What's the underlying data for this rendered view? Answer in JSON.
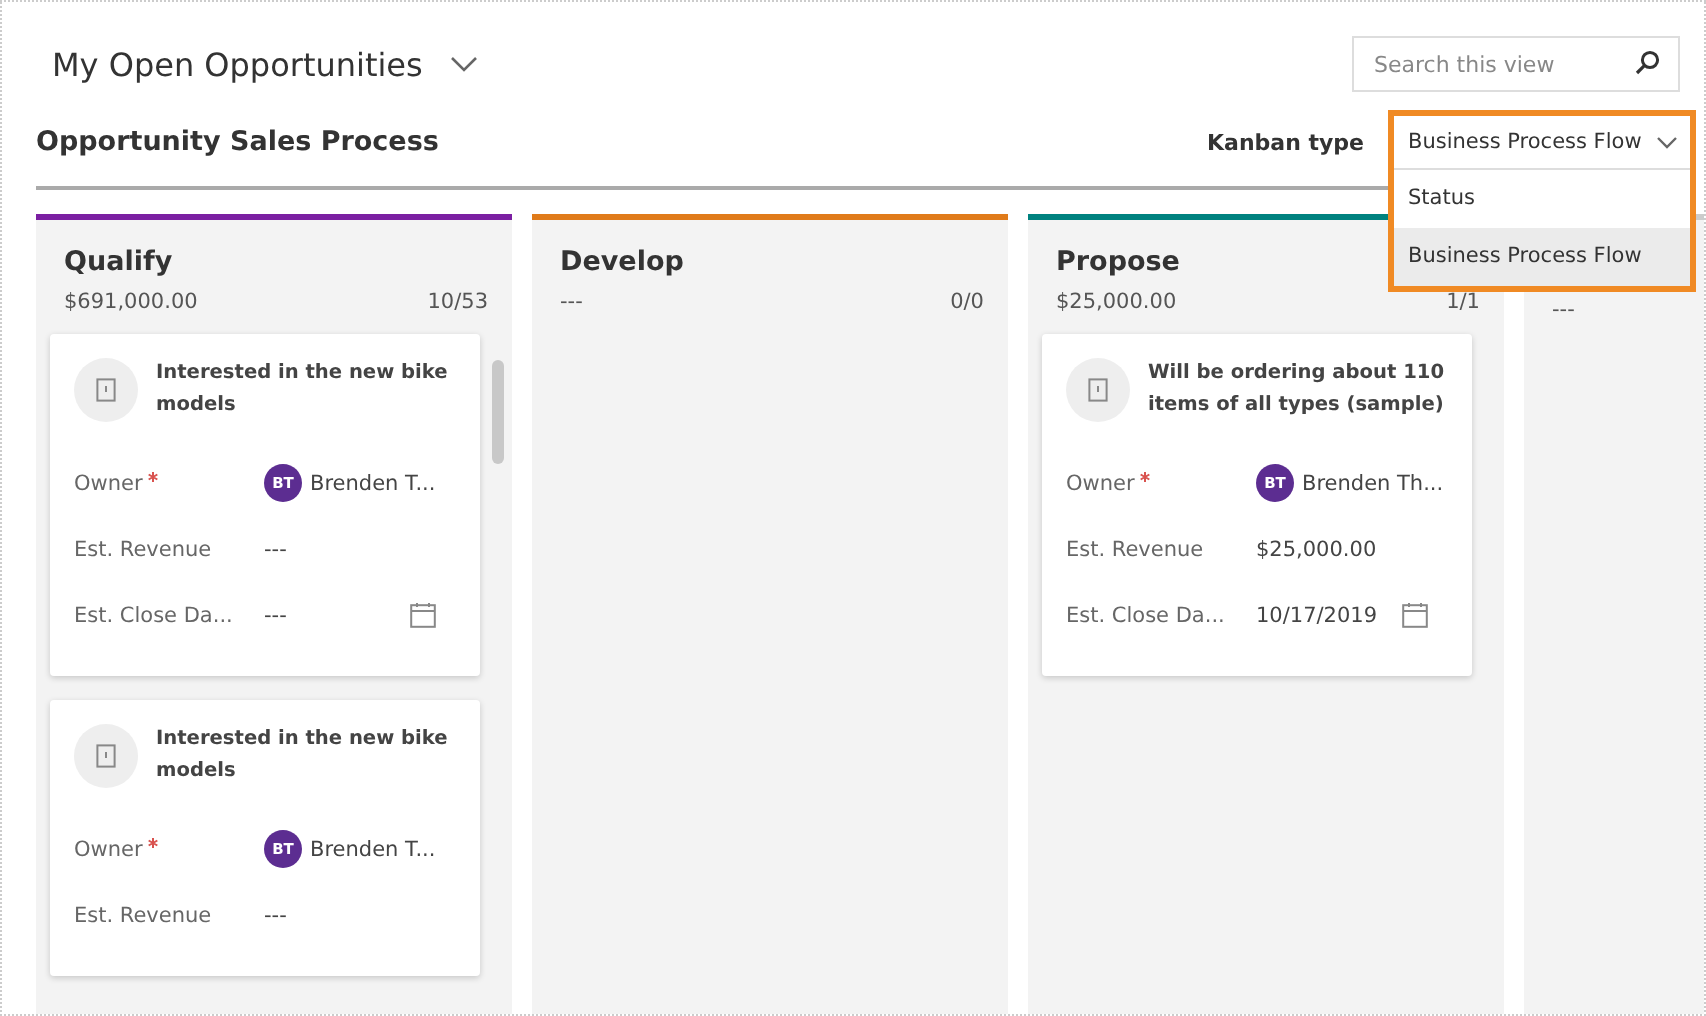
{
  "view": {
    "title": "My Open Opportunities"
  },
  "search": {
    "placeholder": "Search this view"
  },
  "process": {
    "title": "Opportunity Sales Process"
  },
  "kanban_type": {
    "label": "Kanban type",
    "value": "Business Process Flow",
    "expanded": true,
    "highlighted": true,
    "options": [
      {
        "label": "Status",
        "selected": false
      },
      {
        "label": "Business Process Flow",
        "selected": true
      }
    ]
  },
  "columns": [
    {
      "title": "Qualify",
      "total": "$691,000.00",
      "count": "10/53",
      "color": "#7b1fa2",
      "scrollbar": true,
      "cards": [
        {
          "title": "Interested in the new bike models",
          "fields": [
            {
              "kind": "person",
              "label": "Owner",
              "required": true,
              "initials": "BT",
              "value": "Brenden T..."
            },
            {
              "kind": "text",
              "label": "Est. Revenue",
              "required": false,
              "value": "---"
            },
            {
              "kind": "date",
              "label": "Est. Close Da...",
              "required": false,
              "value": "---"
            }
          ]
        },
        {
          "title": "Interested in the new bike models",
          "fields": [
            {
              "kind": "person",
              "label": "Owner",
              "required": true,
              "initials": "BT",
              "value": "Brenden T..."
            },
            {
              "kind": "text",
              "label": "Est. Revenue",
              "required": false,
              "value": "---"
            }
          ]
        }
      ]
    },
    {
      "title": "Develop",
      "total": "---",
      "count": "0/0",
      "color": "#e07b1a",
      "scrollbar": false
    },
    {
      "title": "Propose",
      "total": "$25,000.00",
      "count": "1/1",
      "color": "#00827f",
      "scrollbar": false,
      "cards": [
        {
          "title": "Will be ordering about 110 items of all types (sample)",
          "fields": [
            {
              "kind": "person",
              "label": "Owner",
              "required": true,
              "initials": "BT",
              "value": "Brenden Th..."
            },
            {
              "kind": "text",
              "label": "Est. Revenue",
              "required": false,
              "value": "$25,000.00"
            },
            {
              "kind": "date",
              "label": "Est. Close Da...",
              "required": false,
              "value": "10/17/2019"
            }
          ]
        }
      ]
    },
    {
      "total": "---",
      "color": "#cccccc",
      "scrollbar": false
    }
  ]
}
